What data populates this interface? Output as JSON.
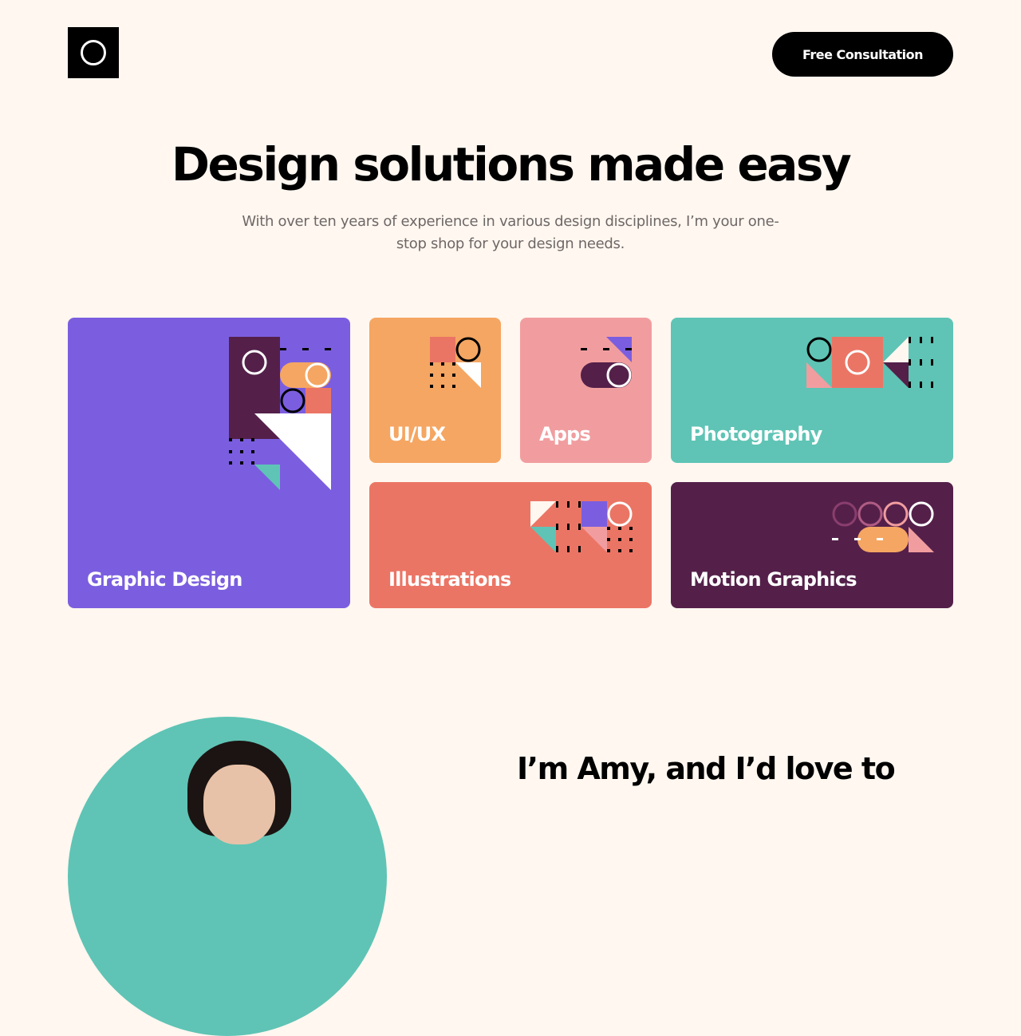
{
  "header": {
    "logo_icon": "ring-logo-icon",
    "cta_label": "Free Consultation"
  },
  "hero": {
    "title": "Design solutions made easy",
    "subtitle": "With over ten years of experience in various design disciplines, I’m your one-stop shop for your design needs."
  },
  "services": [
    {
      "label": "Graphic Design",
      "color": "#7B5EDF"
    },
    {
      "label": "UI/UX",
      "color": "#F5A662"
    },
    {
      "label": "Apps",
      "color": "#F19D9F"
    },
    {
      "label": "Photography",
      "color": "#5FC4B5"
    },
    {
      "label": "Illustrations",
      "color": "#EB7565"
    },
    {
      "label": "Motion Graphics",
      "color": "#54204A"
    }
  ],
  "about": {
    "heading": "I’m Amy, and I’d love to",
    "photo": "portrait-photo"
  },
  "colors": {
    "background": "#FFF7F0",
    "text": "#000000",
    "muted": "#6F6766",
    "purple": "#7B5EDF",
    "orange": "#F5A662",
    "pink": "#F19D9F",
    "teal": "#5FC4B5",
    "coral": "#EB7565",
    "plum": "#54204A"
  }
}
